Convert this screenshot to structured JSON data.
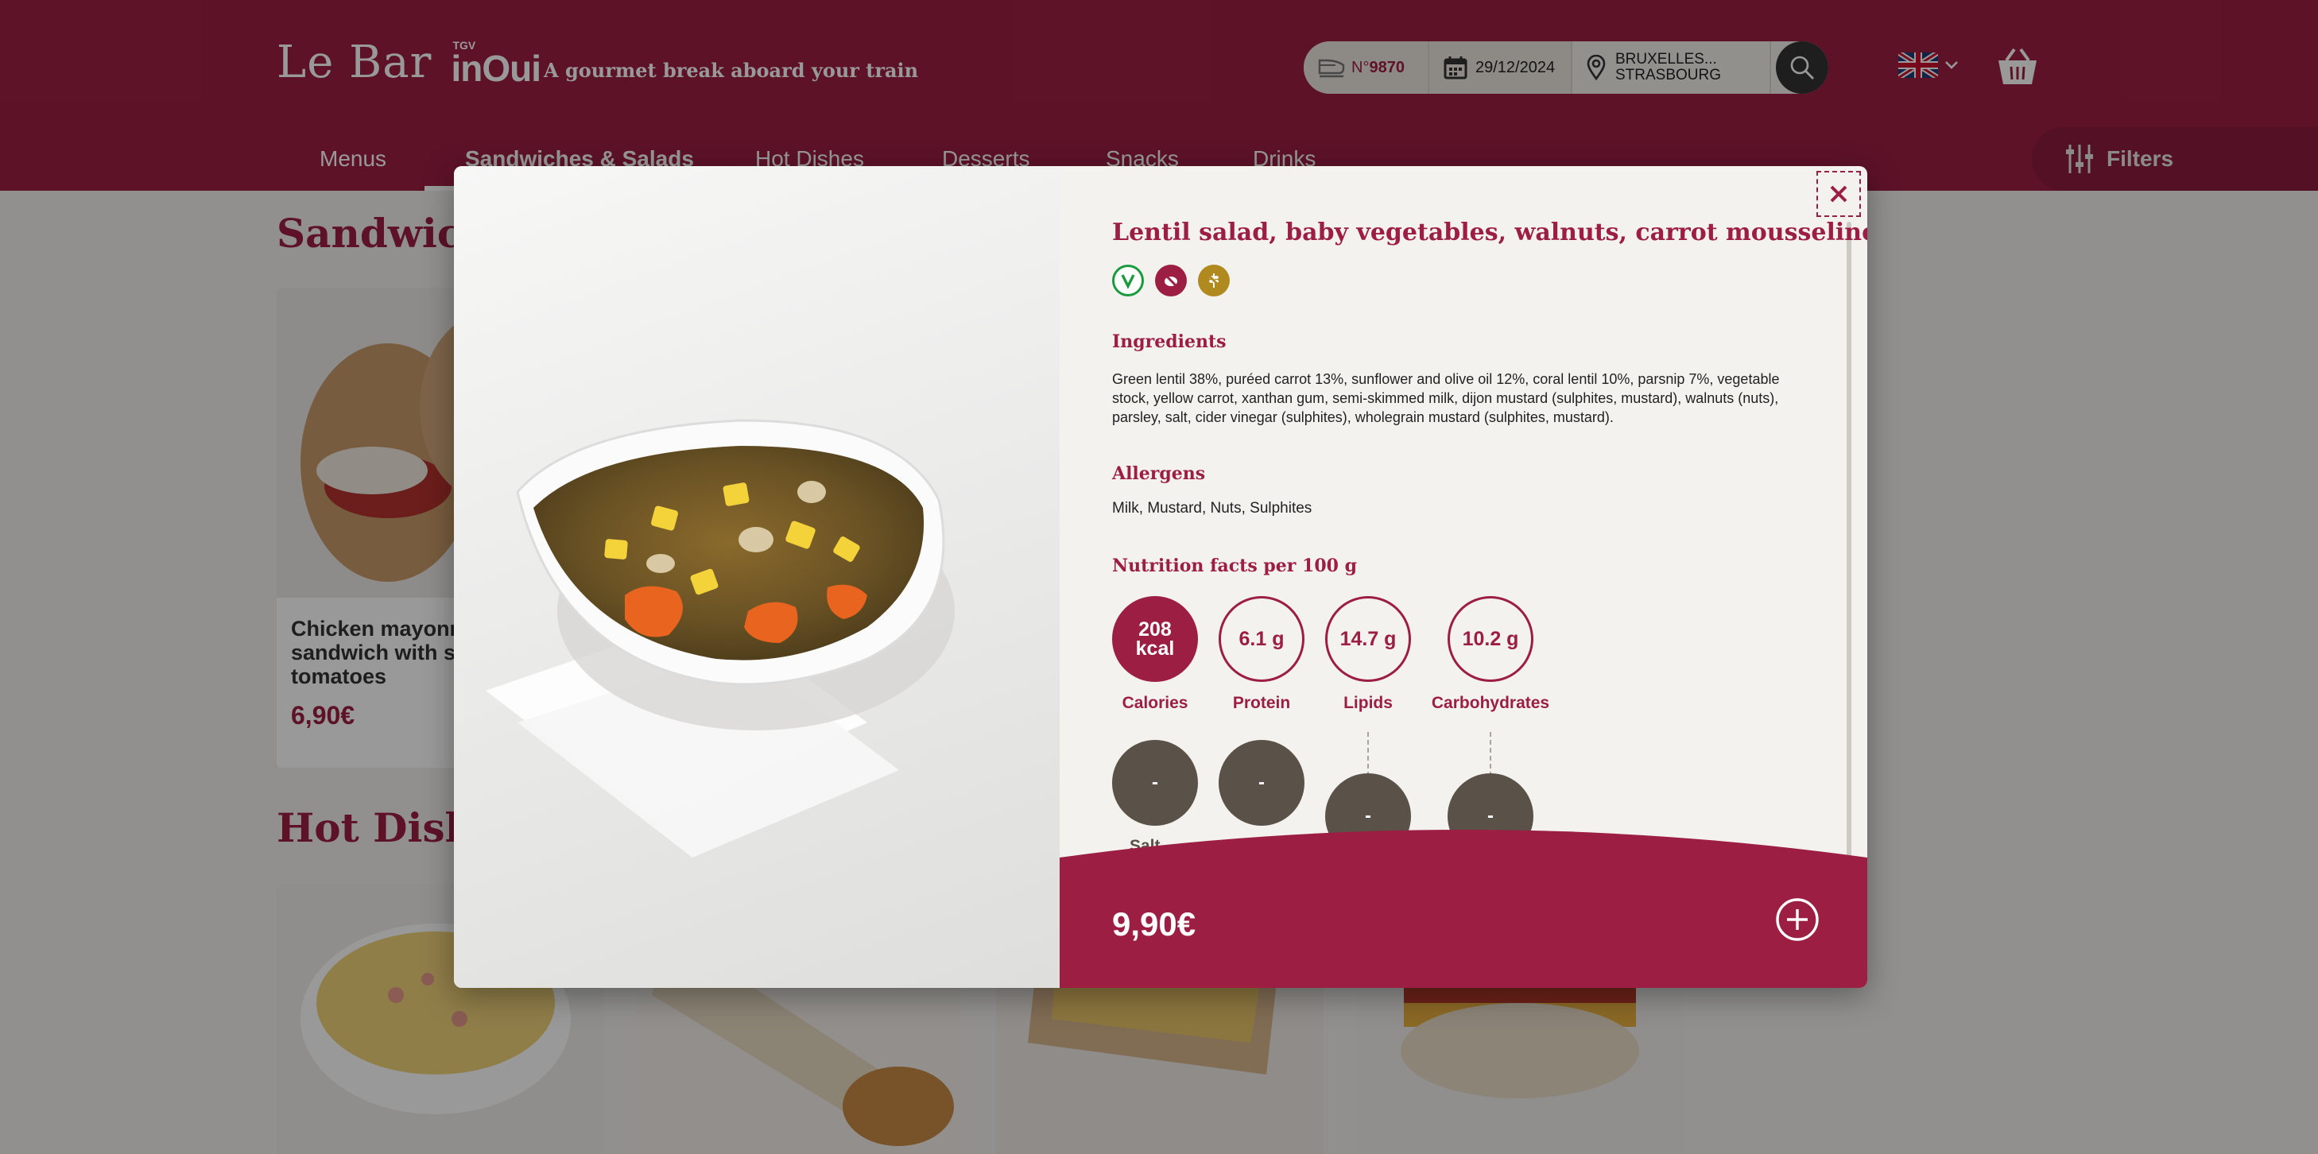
{
  "header": {
    "logo_text": "Le Bar",
    "brand_small": "TGV",
    "brand_main": "inOui",
    "tagline": "A gourmet break aboard your train",
    "search": {
      "train_prefix": "N°",
      "train_number": "9870",
      "date": "29/12/2024",
      "route_line1": "BRUXELLES...",
      "route_line2": "STRASBOURG"
    },
    "language": "EN"
  },
  "nav": {
    "items": [
      {
        "label": "Menus"
      },
      {
        "label": "Sandwiches & Salads"
      },
      {
        "label": "Hot Dishes"
      },
      {
        "label": "Desserts"
      },
      {
        "label": "Snacks"
      },
      {
        "label": "Drinks"
      }
    ],
    "filters_label": "Filters"
  },
  "sections": {
    "sandwiches_title": "Sandwiches & Salads",
    "hot_title": "Hot Dishes",
    "card": {
      "name": "Chicken mayonnaise sandwich with semi-dried tomatoes",
      "price": "6,90€"
    }
  },
  "modal": {
    "title": "Lentil salad, baby vegetables, walnuts, carrot mousseline",
    "diet_icons": [
      "vegetarian-icon",
      "no-pork-icon",
      "gluten-free-icon"
    ],
    "ingredients_label": "Ingredients",
    "ingredients_text": "Green lentil 38%, puréed carrot 13%, sunflower and olive oil 12%, coral lentil 10%, parsnip 7%, vegetable stock, yellow carrot, xanthan gum, semi-skimmed milk, dijon mustard (sulphites, mustard), walnuts (nuts), parsley, salt, cider vinegar (sulphites), wholegrain mustard (sulphites, mustard).",
    "allergens_label": "Allergens",
    "allergens_text": "Milk, Mustard, Nuts, Sulphites",
    "nutrition_label": "Nutrition facts per 100 g",
    "nutrition": {
      "calories_value": "208",
      "calories_unit": "kcal",
      "calories_label": "Calories",
      "protein_value": "6.1 g",
      "protein_label": "Protein",
      "lipids_value": "14.7 g",
      "lipids_label": "Lipids",
      "carbs_value": "10.2 g",
      "carbs_label": "Carbohydrates",
      "sub_values": [
        "-",
        "-",
        "-",
        "-"
      ],
      "salt_label": "Salt"
    },
    "price": "9,90€"
  },
  "colors": {
    "brand": "#9c1f43",
    "dark": "#5a5148",
    "vegetarian": "#1a9b3d",
    "gluten_free": "#b08a1e"
  }
}
